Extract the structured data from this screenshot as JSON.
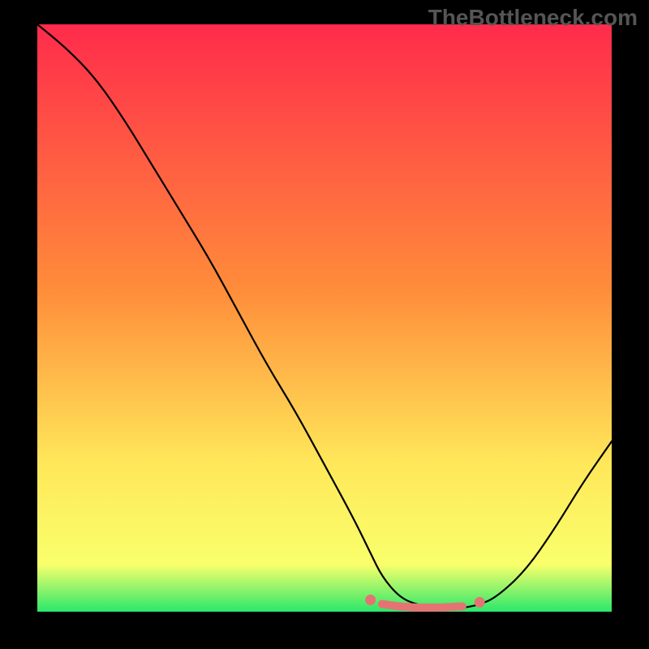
{
  "watermark": "TheBottleneck.com",
  "chart_data": {
    "type": "line",
    "title": "",
    "xlabel": "",
    "ylabel": "",
    "xlim": [
      0,
      100
    ],
    "ylim": [
      0,
      100
    ],
    "grid": false,
    "x": [
      0,
      5,
      10,
      15,
      20,
      25,
      30,
      35,
      40,
      45,
      50,
      55,
      58,
      60,
      63,
      66,
      70,
      74,
      77,
      80,
      85,
      90,
      95,
      100
    ],
    "y": [
      100,
      96,
      91,
      84,
      76,
      68,
      60,
      51,
      42,
      34,
      25,
      16,
      10,
      6,
      2.5,
      1.2,
      0.6,
      0.6,
      1.2,
      2.5,
      7,
      14,
      22,
      29
    ],
    "highlight": {
      "color": "#e57373",
      "dots_x": [
        58,
        77
      ],
      "dots_y": [
        2.0,
        1.6
      ],
      "segment_x": [
        60,
        63,
        66,
        70,
        74
      ],
      "segment_y": [
        1.3,
        0.9,
        0.7,
        0.7,
        0.9
      ]
    },
    "gradient_stops": [
      {
        "offset": 0,
        "color": "#FF2B4B"
      },
      {
        "offset": 45,
        "color": "#FF8C3A"
      },
      {
        "offset": 75,
        "color": "#FFE85A"
      },
      {
        "offset": 92,
        "color": "#F9FF6B"
      },
      {
        "offset": 100,
        "color": "#2AE86B"
      }
    ]
  }
}
